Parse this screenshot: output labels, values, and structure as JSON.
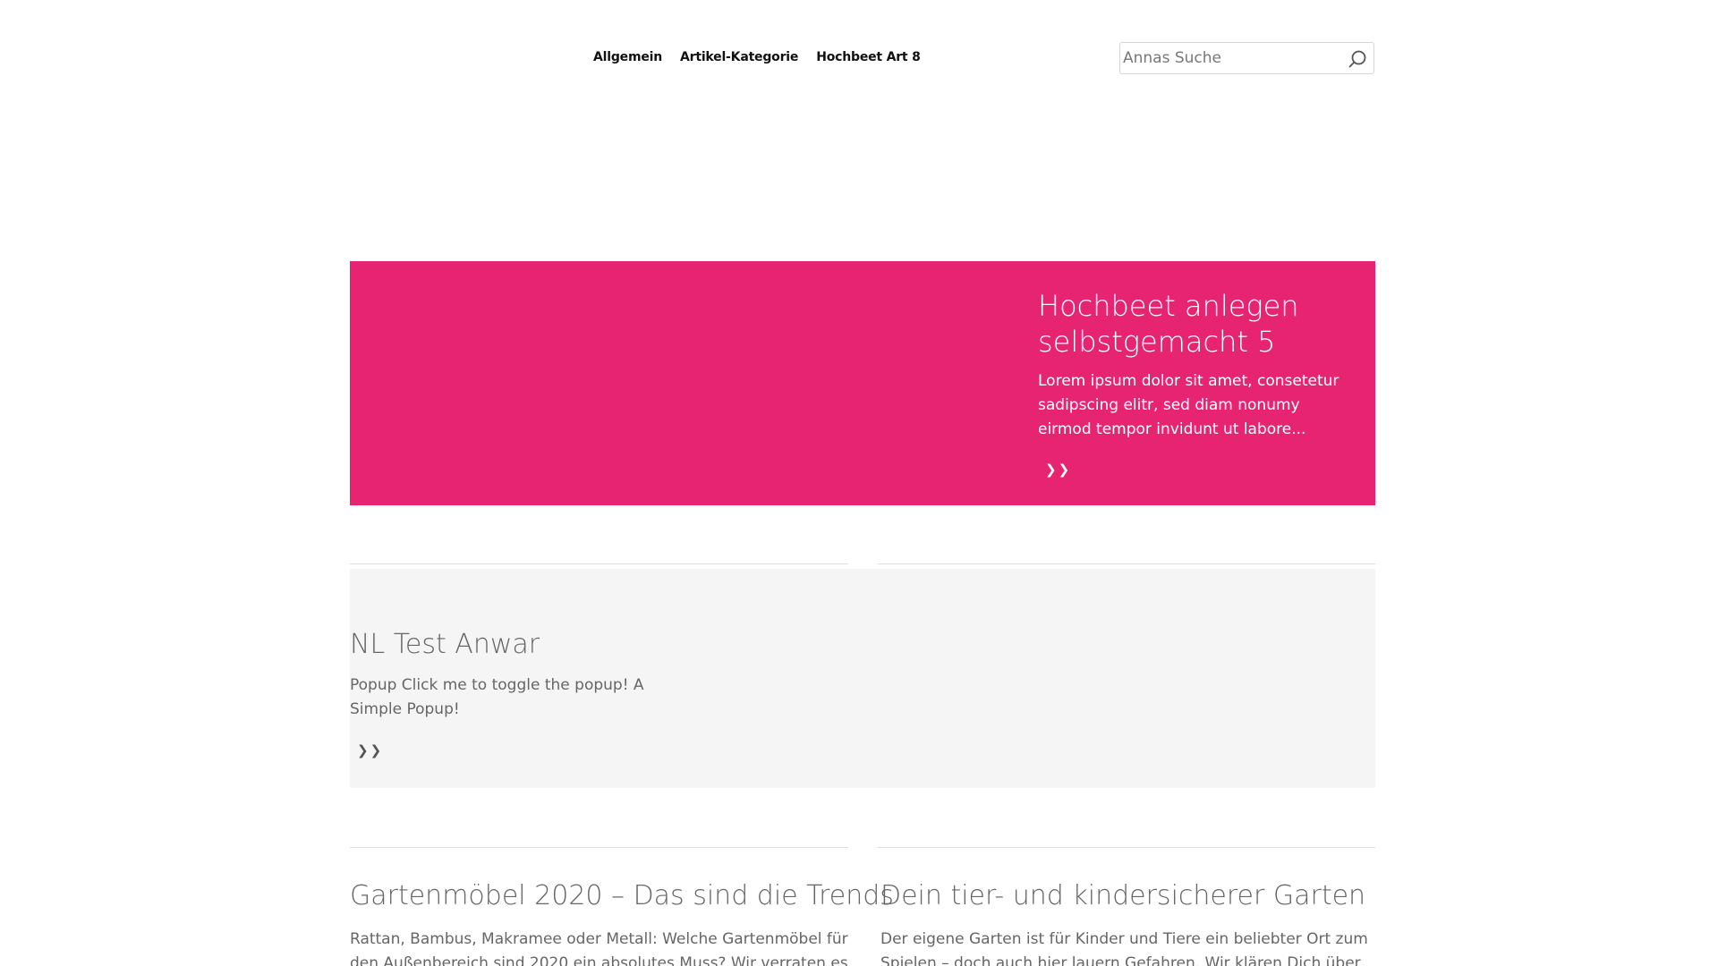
{
  "nav": {
    "items": [
      "Allgemein",
      "Artikel-Kategorie",
      "Hochbeet Art 8"
    ]
  },
  "search": {
    "placeholder": "Annas Suche",
    "icon": "search-icon"
  },
  "hero": {
    "background": "#e62472",
    "title": "Hochbeet anlegen selbstgemacht 5",
    "description": "Lorem ipsum dolor sit amet, consetetur sadipscing elitr, sed diam nonumy eirmod tempor invidunt ut labore...",
    "more": "❯❯"
  },
  "feature": {
    "title": "NL Test Anwar",
    "description": "Popup Click me to toggle the popup! A Simple Popup!",
    "more": "❯❯"
  },
  "articles": [
    {
      "title": "Gartenmöbel 2020 – Das sind die Trends",
      "excerpt": "Rattan, Bambus, Makramee oder Metall: Welche Gartenmöbel für den Außenbereich sind 2020 ein absolutes Muss? Wir verraten es dir."
    },
    {
      "title": "Dein tier- und kindersicherer Garten",
      "excerpt": "Der eigene Garten ist für Kinder und Tiere ein beliebter Ort zum Spielen – doch auch hier lauern Gefahren. Wir klären Dich über die"
    }
  ]
}
